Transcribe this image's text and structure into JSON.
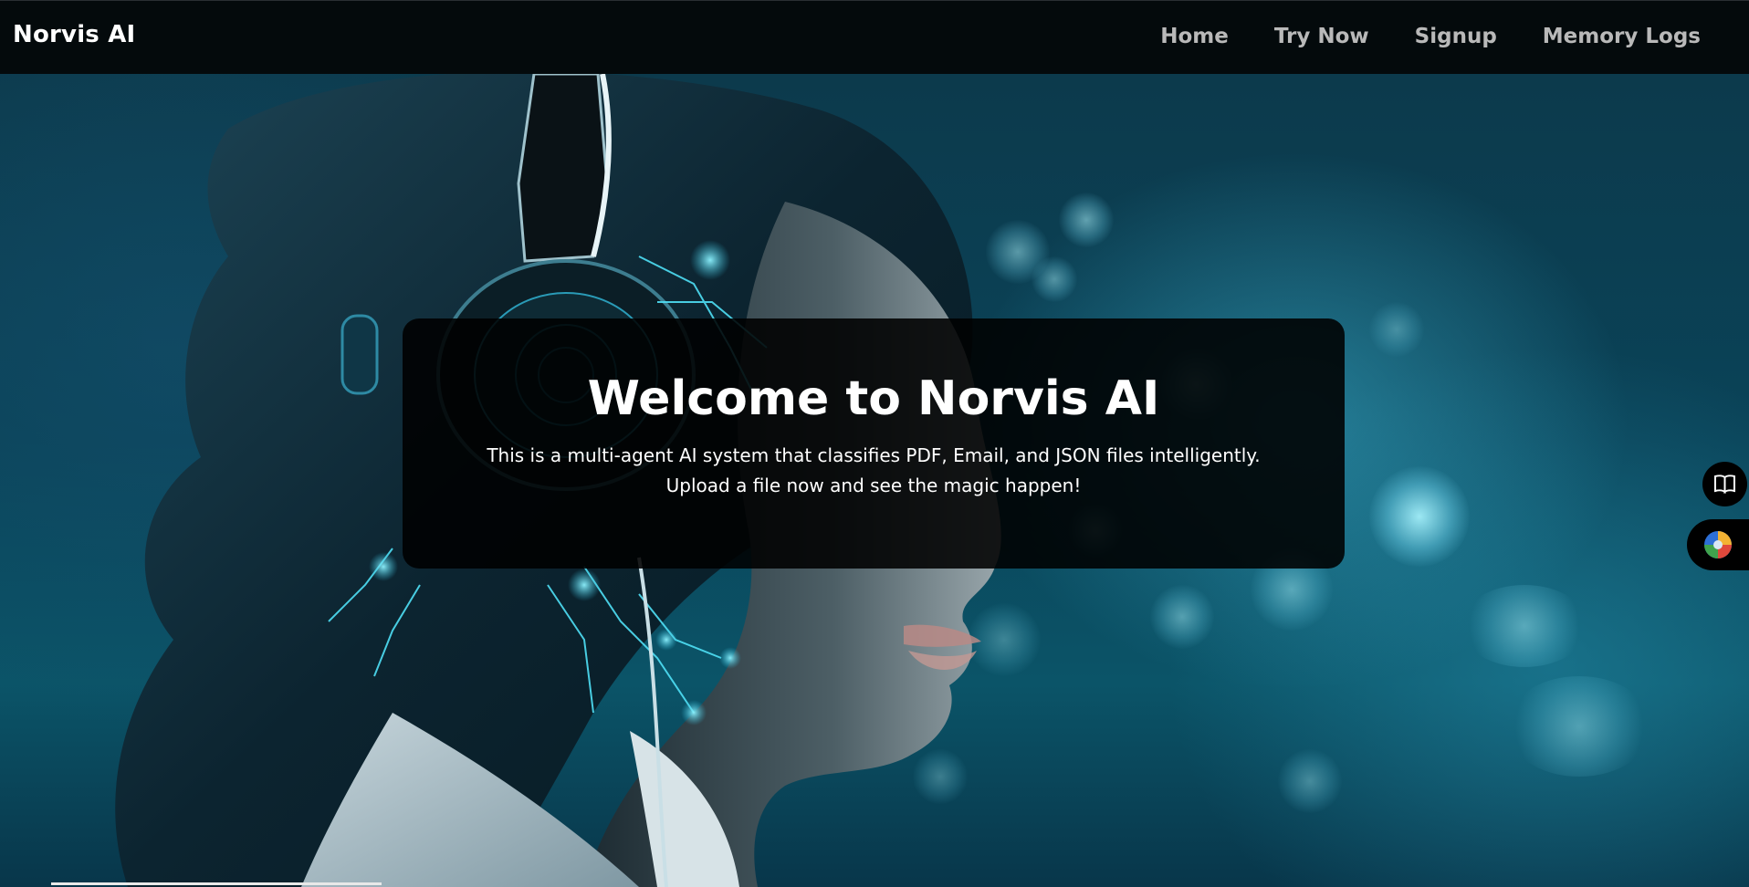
{
  "brand": "Norvis AI",
  "nav": [
    {
      "label": "Home"
    },
    {
      "label": "Try Now"
    },
    {
      "label": "Signup"
    },
    {
      "label": "Memory Logs"
    }
  ],
  "hero": {
    "title": "Welcome to Norvis AI",
    "line1": "This is a multi-agent AI system that classifies PDF, Email, and JSON files intelligently.",
    "line2": "Upload a file now and see the magic happen!"
  },
  "side_buttons": [
    {
      "icon": "book-icon"
    },
    {
      "icon": "palette-icon"
    }
  ],
  "colors": {
    "navbar_bg": "#040a0c",
    "nav_text": "#b9b9b9",
    "brand_text": "#ffffff",
    "hero_accent": "#46c8e6",
    "card_bg": "#000000"
  }
}
